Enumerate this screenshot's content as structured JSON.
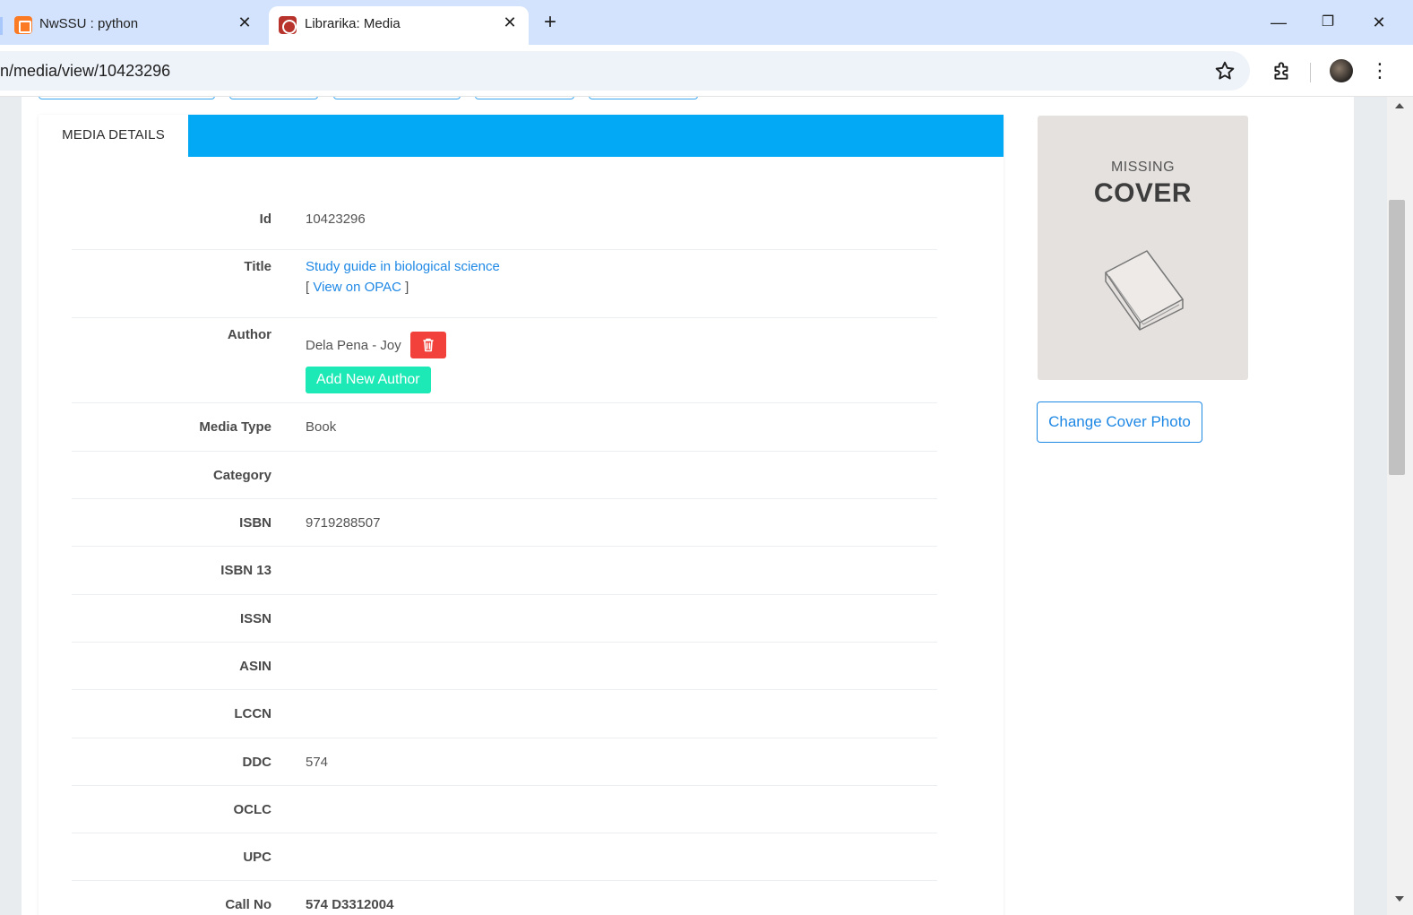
{
  "browser": {
    "tabs": [
      {
        "title": "NwSSU : python",
        "favicon": "xampp-icon"
      },
      {
        "title": "Librarika: Media",
        "favicon": "librarika-icon"
      }
    ],
    "url": "n/media/view/10423296",
    "window_controls": {
      "minimize": "—",
      "restore": "❐",
      "close": "✕"
    },
    "close_glyph": "✕",
    "new_tab_glyph": "+",
    "menu_glyph": "⋮"
  },
  "panel": {
    "tab_label": "MEDIA DETAILS"
  },
  "details": {
    "id": {
      "label": "Id",
      "value": "10423296"
    },
    "title": {
      "label": "Title",
      "value": "Study guide in biological science",
      "opac_open": "[ ",
      "opac_link": "View on OPAC",
      "opac_close": " ]"
    },
    "author": {
      "label": "Author",
      "value": "Dela Pena - Joy",
      "add_button": "Add New Author"
    },
    "media_type": {
      "label": "Media Type",
      "value": "Book"
    },
    "category": {
      "label": "Category",
      "value": ""
    },
    "isbn": {
      "label": "ISBN",
      "value": "9719288507"
    },
    "isbn13": {
      "label": "ISBN 13",
      "value": ""
    },
    "issn": {
      "label": "ISSN",
      "value": ""
    },
    "asin": {
      "label": "ASIN",
      "value": ""
    },
    "lccn": {
      "label": "LCCN",
      "value": ""
    },
    "ddc": {
      "label": "DDC",
      "value": "574"
    },
    "oclc": {
      "label": "OCLC",
      "value": ""
    },
    "upc": {
      "label": "UPC",
      "value": ""
    },
    "call_no": {
      "label": "Call No",
      "value": "574 D3312004"
    }
  },
  "cover": {
    "line1": "MISSING",
    "line2": "COVER",
    "change_button": "Change Cover Photo"
  },
  "colors": {
    "panel_header": "#03a9f4",
    "link": "#1e88e5",
    "delete_button": "#f1413a",
    "add_button": "#1de9b6"
  }
}
